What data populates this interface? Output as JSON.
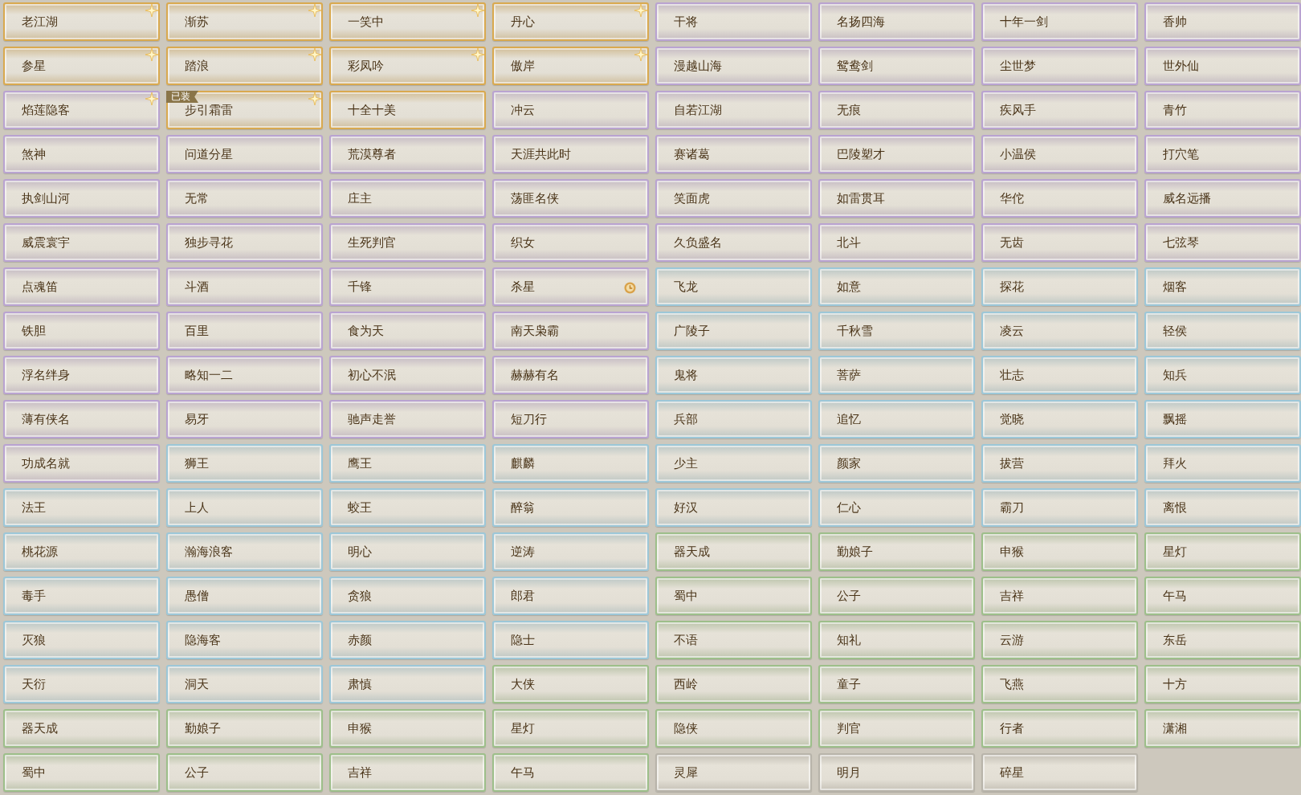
{
  "titles": [
    {
      "name": "老江湖",
      "color": "#d9a94f",
      "starred": true,
      "timed": false
    },
    {
      "name": "渐苏",
      "color": "#d9a94f",
      "starred": true,
      "timed": false
    },
    {
      "name": "一笑中",
      "color": "#d9a94f",
      "starred": true,
      "timed": false
    },
    {
      "name": "丹心",
      "color": "#d9a94f",
      "starred": true,
      "timed": false
    },
    {
      "name": "干将",
      "color": "#b9a3d1",
      "starred": false,
      "timed": false
    },
    {
      "name": "名扬四海",
      "color": "#b9a3d1",
      "starred": false,
      "timed": false
    },
    {
      "name": "十年一剑",
      "color": "#b9a3d1",
      "starred": false,
      "timed": false
    },
    {
      "name": "香帅",
      "color": "#b9a3d1",
      "starred": false,
      "timed": false
    },
    {
      "name": "参星",
      "color": "#d9a94f",
      "starred": true,
      "timed": false
    },
    {
      "name": "踏浪",
      "color": "#d9a94f",
      "starred": true,
      "timed": false
    },
    {
      "name": "彩凤吟",
      "color": "#d9a94f",
      "starred": true,
      "timed": false
    },
    {
      "name": "傲岸",
      "color": "#d9a94f",
      "starred": true,
      "timed": false
    },
    {
      "name": "漫越山海",
      "color": "#b9a3d1",
      "starred": false,
      "timed": false
    },
    {
      "name": "鸳鸯剑",
      "color": "#b9a3d1",
      "starred": false,
      "timed": false
    },
    {
      "name": "尘世梦",
      "color": "#b9a3d1",
      "starred": false,
      "timed": false
    },
    {
      "name": "世外仙",
      "color": "#b9a3d1",
      "starred": false,
      "timed": false
    },
    {
      "name": "焰莲隐客",
      "color": "#b9a3d1",
      "starred": true,
      "timed": false
    },
    {
      "name": "步引霜雷",
      "color": "#d9a94f",
      "starred": true,
      "timed": false,
      "badge": "已装"
    },
    {
      "name": "十全十美",
      "color": "#d9a94f",
      "starred": false,
      "timed": false
    },
    {
      "name": "冲云",
      "color": "#b9a3d1",
      "starred": false,
      "timed": false
    },
    {
      "name": "自若江湖",
      "color": "#b9a3d1",
      "starred": false,
      "timed": false
    },
    {
      "name": "无痕",
      "color": "#b9a3d1",
      "starred": false,
      "timed": false
    },
    {
      "name": "疾风手",
      "color": "#b9a3d1",
      "starred": false,
      "timed": false
    },
    {
      "name": "青竹",
      "color": "#b9a3d1",
      "starred": false,
      "timed": false
    },
    {
      "name": "煞神",
      "color": "#b9a3d1",
      "starred": false,
      "timed": false
    },
    {
      "name": "问道分星",
      "color": "#b9a3d1",
      "starred": false,
      "timed": false
    },
    {
      "name": "荒漠尊者",
      "color": "#b9a3d1",
      "starred": false,
      "timed": false
    },
    {
      "name": "天涯共此时",
      "color": "#b9a3d1",
      "starred": false,
      "timed": false
    },
    {
      "name": "赛诸葛",
      "color": "#b9a3d1",
      "starred": false,
      "timed": false
    },
    {
      "name": "巴陵塑才",
      "color": "#b9a3d1",
      "starred": false,
      "timed": false
    },
    {
      "name": "小温侯",
      "color": "#b9a3d1",
      "starred": false,
      "timed": false
    },
    {
      "name": "打穴笔",
      "color": "#b9a3d1",
      "starred": false,
      "timed": false
    },
    {
      "name": "执剑山河",
      "color": "#b9a3d1",
      "starred": false,
      "timed": false
    },
    {
      "name": "无常",
      "color": "#b9a3d1",
      "starred": false,
      "timed": false
    },
    {
      "name": "庄主",
      "color": "#b9a3d1",
      "starred": false,
      "timed": false
    },
    {
      "name": "荡匪名侠",
      "color": "#b9a3d1",
      "starred": false,
      "timed": false
    },
    {
      "name": "笑面虎",
      "color": "#b9a3d1",
      "starred": false,
      "timed": false
    },
    {
      "name": "如雷贯耳",
      "color": "#b9a3d1",
      "starred": false,
      "timed": false
    },
    {
      "name": "华佗",
      "color": "#b9a3d1",
      "starred": false,
      "timed": false
    },
    {
      "name": "威名远播",
      "color": "#b9a3d1",
      "starred": false,
      "timed": false
    },
    {
      "name": "威震寰宇",
      "color": "#b9a3d1",
      "starred": false,
      "timed": false
    },
    {
      "name": "独步寻花",
      "color": "#b9a3d1",
      "starred": false,
      "timed": false
    },
    {
      "name": "生死判官",
      "color": "#b9a3d1",
      "starred": false,
      "timed": false
    },
    {
      "name": "织女",
      "color": "#b9a3d1",
      "starred": false,
      "timed": false
    },
    {
      "name": "久负盛名",
      "color": "#b9a3d1",
      "starred": false,
      "timed": false
    },
    {
      "name": "北斗",
      "color": "#b9a3d1",
      "starred": false,
      "timed": false
    },
    {
      "name": "无齿",
      "color": "#b9a3d1",
      "starred": false,
      "timed": false
    },
    {
      "name": "七弦琴",
      "color": "#b9a3d1",
      "starred": false,
      "timed": false
    },
    {
      "name": "点魂笛",
      "color": "#b9a3d1",
      "starred": false,
      "timed": false
    },
    {
      "name": "斗酒",
      "color": "#b9a3d1",
      "starred": false,
      "timed": false
    },
    {
      "name": "千锋",
      "color": "#b9a3d1",
      "starred": false,
      "timed": false
    },
    {
      "name": "杀星",
      "color": "#b9a3d1",
      "starred": false,
      "timed": true
    },
    {
      "name": "飞龙",
      "color": "#9cc7d8",
      "starred": false,
      "timed": false
    },
    {
      "name": "如意",
      "color": "#9cc7d8",
      "starred": false,
      "timed": false
    },
    {
      "name": "探花",
      "color": "#9cc7d8",
      "starred": false,
      "timed": false
    },
    {
      "name": "烟客",
      "color": "#9cc7d8",
      "starred": false,
      "timed": false
    },
    {
      "name": "铁胆",
      "color": "#b9a3d1",
      "starred": false,
      "timed": false
    },
    {
      "name": "百里",
      "color": "#b9a3d1",
      "starred": false,
      "timed": false
    },
    {
      "name": "食为天",
      "color": "#b9a3d1",
      "starred": false,
      "timed": false
    },
    {
      "name": "南天枭霸",
      "color": "#b9a3d1",
      "starred": false,
      "timed": false
    },
    {
      "name": "广陵子",
      "color": "#9cc7d8",
      "starred": false,
      "timed": false
    },
    {
      "name": "千秋雪",
      "color": "#9cc7d8",
      "starred": false,
      "timed": false
    },
    {
      "name": "凌云",
      "color": "#9cc7d8",
      "starred": false,
      "timed": false
    },
    {
      "name": "轻侯",
      "color": "#9cc7d8",
      "starred": false,
      "timed": false
    },
    {
      "name": "浮名绊身",
      "color": "#b9a3d1",
      "starred": false,
      "timed": false
    },
    {
      "name": "略知一二",
      "color": "#b9a3d1",
      "starred": false,
      "timed": false
    },
    {
      "name": "初心不泯",
      "color": "#b9a3d1",
      "starred": false,
      "timed": false
    },
    {
      "name": "赫赫有名",
      "color": "#b9a3d1",
      "starred": false,
      "timed": false
    },
    {
      "name": "鬼将",
      "color": "#9cc7d8",
      "starred": false,
      "timed": false
    },
    {
      "name": "菩萨",
      "color": "#9cc7d8",
      "starred": false,
      "timed": false
    },
    {
      "name": "壮志",
      "color": "#9cc7d8",
      "starred": false,
      "timed": false
    },
    {
      "name": "知兵",
      "color": "#9cc7d8",
      "starred": false,
      "timed": false
    },
    {
      "name": "薄有侠名",
      "color": "#b9a3d1",
      "starred": false,
      "timed": false
    },
    {
      "name": "易牙",
      "color": "#b9a3d1",
      "starred": false,
      "timed": false
    },
    {
      "name": "驰声走誉",
      "color": "#b9a3d1",
      "starred": false,
      "timed": false
    },
    {
      "name": "短刀行",
      "color": "#b9a3d1",
      "starred": false,
      "timed": false
    },
    {
      "name": "兵部",
      "color": "#9cc7d8",
      "starred": false,
      "timed": false
    },
    {
      "name": "追忆",
      "color": "#9cc7d8",
      "starred": false,
      "timed": false
    },
    {
      "name": "觉晓",
      "color": "#9cc7d8",
      "starred": false,
      "timed": false
    },
    {
      "name": "飘摇",
      "color": "#9cc7d8",
      "starred": false,
      "timed": false
    },
    {
      "name": "功成名就",
      "color": "#b9a3d1",
      "starred": false,
      "timed": false
    },
    {
      "name": "狮王",
      "color": "#9cc7d8",
      "starred": false,
      "timed": false
    },
    {
      "name": "鹰王",
      "color": "#9cc7d8",
      "starred": false,
      "timed": false
    },
    {
      "name": "麒麟",
      "color": "#9cc7d8",
      "starred": false,
      "timed": false
    },
    {
      "name": "少主",
      "color": "#9cc7d8",
      "starred": false,
      "timed": false
    },
    {
      "name": "颜家",
      "color": "#9cc7d8",
      "starred": false,
      "timed": false
    },
    {
      "name": "拔营",
      "color": "#9cc7d8",
      "starred": false,
      "timed": false
    },
    {
      "name": "拜火",
      "color": "#9cc7d8",
      "starred": false,
      "timed": false
    },
    {
      "name": "法王",
      "color": "#9cc7d8",
      "starred": false,
      "timed": false
    },
    {
      "name": "上人",
      "color": "#9cc7d8",
      "starred": false,
      "timed": false
    },
    {
      "name": "蛟王",
      "color": "#9cc7d8",
      "starred": false,
      "timed": false
    },
    {
      "name": "醉翁",
      "color": "#9cc7d8",
      "starred": false,
      "timed": false
    },
    {
      "name": "好汉",
      "color": "#9cc7d8",
      "starred": false,
      "timed": false
    },
    {
      "name": "仁心",
      "color": "#9cc7d8",
      "starred": false,
      "timed": false
    },
    {
      "name": "霸刀",
      "color": "#9cc7d8",
      "starred": false,
      "timed": false
    },
    {
      "name": "离恨",
      "color": "#9cc7d8",
      "starred": false,
      "timed": false
    },
    {
      "name": "桃花源",
      "color": "#9cc7d8",
      "starred": false,
      "timed": false
    },
    {
      "name": "瀚海浪客",
      "color": "#9cc7d8",
      "starred": false,
      "timed": false
    },
    {
      "name": "明心",
      "color": "#9cc7d8",
      "starred": false,
      "timed": false
    },
    {
      "name": "逆涛",
      "color": "#9cc7d8",
      "starred": false,
      "timed": false
    },
    {
      "name": "器天成",
      "color": "#9dbf8a",
      "starred": false,
      "timed": false
    },
    {
      "name": "勤娘子",
      "color": "#9dbf8a",
      "starred": false,
      "timed": false
    },
    {
      "name": "申猴",
      "color": "#9dbf8a",
      "starred": false,
      "timed": false
    },
    {
      "name": "星灯",
      "color": "#9dbf8a",
      "starred": false,
      "timed": false
    },
    {
      "name": "毒手",
      "color": "#9cc7d8",
      "starred": false,
      "timed": false
    },
    {
      "name": "愚僧",
      "color": "#9cc7d8",
      "starred": false,
      "timed": false
    },
    {
      "name": "贪狼",
      "color": "#9cc7d8",
      "starred": false,
      "timed": false
    },
    {
      "name": "郎君",
      "color": "#9cc7d8",
      "starred": false,
      "timed": false
    },
    {
      "name": "蜀中",
      "color": "#9dbf8a",
      "starred": false,
      "timed": false
    },
    {
      "name": "公子",
      "color": "#9dbf8a",
      "starred": false,
      "timed": false
    },
    {
      "name": "吉祥",
      "color": "#9dbf8a",
      "starred": false,
      "timed": false
    },
    {
      "name": "午马",
      "color": "#9dbf8a",
      "starred": false,
      "timed": false
    },
    {
      "name": "灭狼",
      "color": "#9cc7d8",
      "starred": false,
      "timed": false
    },
    {
      "name": "隐海客",
      "color": "#9cc7d8",
      "starred": false,
      "timed": false
    },
    {
      "name": "赤颜",
      "color": "#9cc7d8",
      "starred": false,
      "timed": false
    },
    {
      "name": "隐士",
      "color": "#9cc7d8",
      "starred": false,
      "timed": false
    },
    {
      "name": "不语",
      "color": "#9dbf8a",
      "starred": false,
      "timed": false
    },
    {
      "name": "知礼",
      "color": "#9dbf8a",
      "starred": false,
      "timed": false
    },
    {
      "name": "云游",
      "color": "#9dbf8a",
      "starred": false,
      "timed": false
    },
    {
      "name": "东岳",
      "color": "#9dbf8a",
      "starred": false,
      "timed": false
    },
    {
      "name": "天衍",
      "color": "#9cc7d8",
      "starred": false,
      "timed": false
    },
    {
      "name": "洞天",
      "color": "#9cc7d8",
      "starred": false,
      "timed": false
    },
    {
      "name": "肃慎",
      "color": "#9cc7d8",
      "starred": false,
      "timed": false
    },
    {
      "name": "大侠",
      "color": "#9dbf8a",
      "starred": false,
      "timed": false
    },
    {
      "name": "西岭",
      "color": "#9dbf8a",
      "starred": false,
      "timed": false
    },
    {
      "name": "童子",
      "color": "#9dbf8a",
      "starred": false,
      "timed": false
    },
    {
      "name": "飞燕",
      "color": "#9dbf8a",
      "starred": false,
      "timed": false
    },
    {
      "name": "十方",
      "color": "#9dbf8a",
      "starred": false,
      "timed": false
    },
    {
      "name": "器天成",
      "color": "#9dbf8a",
      "starred": false,
      "timed": false
    },
    {
      "name": "勤娘子",
      "color": "#9dbf8a",
      "starred": false,
      "timed": false
    },
    {
      "name": "申猴",
      "color": "#9dbf8a",
      "starred": false,
      "timed": false
    },
    {
      "name": "星灯",
      "color": "#9dbf8a",
      "starred": false,
      "timed": false
    },
    {
      "name": "隐侠",
      "color": "#9dbf8a",
      "starred": false,
      "timed": false
    },
    {
      "name": "判官",
      "color": "#9dbf8a",
      "starred": false,
      "timed": false
    },
    {
      "name": "行者",
      "color": "#9dbf8a",
      "starred": false,
      "timed": false
    },
    {
      "name": "潇湘",
      "color": "#9dbf8a",
      "starred": false,
      "timed": false
    },
    {
      "name": "蜀中",
      "color": "#9dbf8a",
      "starred": false,
      "timed": false
    },
    {
      "name": "公子",
      "color": "#9dbf8a",
      "starred": false,
      "timed": false
    },
    {
      "name": "吉祥",
      "color": "#9dbf8a",
      "starred": false,
      "timed": false
    },
    {
      "name": "午马",
      "color": "#9dbf8a",
      "starred": false,
      "timed": false
    },
    {
      "name": "灵犀",
      "color": "#b8b4aa",
      "starred": false,
      "timed": false
    },
    {
      "name": "明月",
      "color": "#b8b4aa",
      "starred": false,
      "timed": false
    },
    {
      "name": "碎星",
      "color": "#b8b4aa",
      "starred": false,
      "timed": false
    }
  ]
}
